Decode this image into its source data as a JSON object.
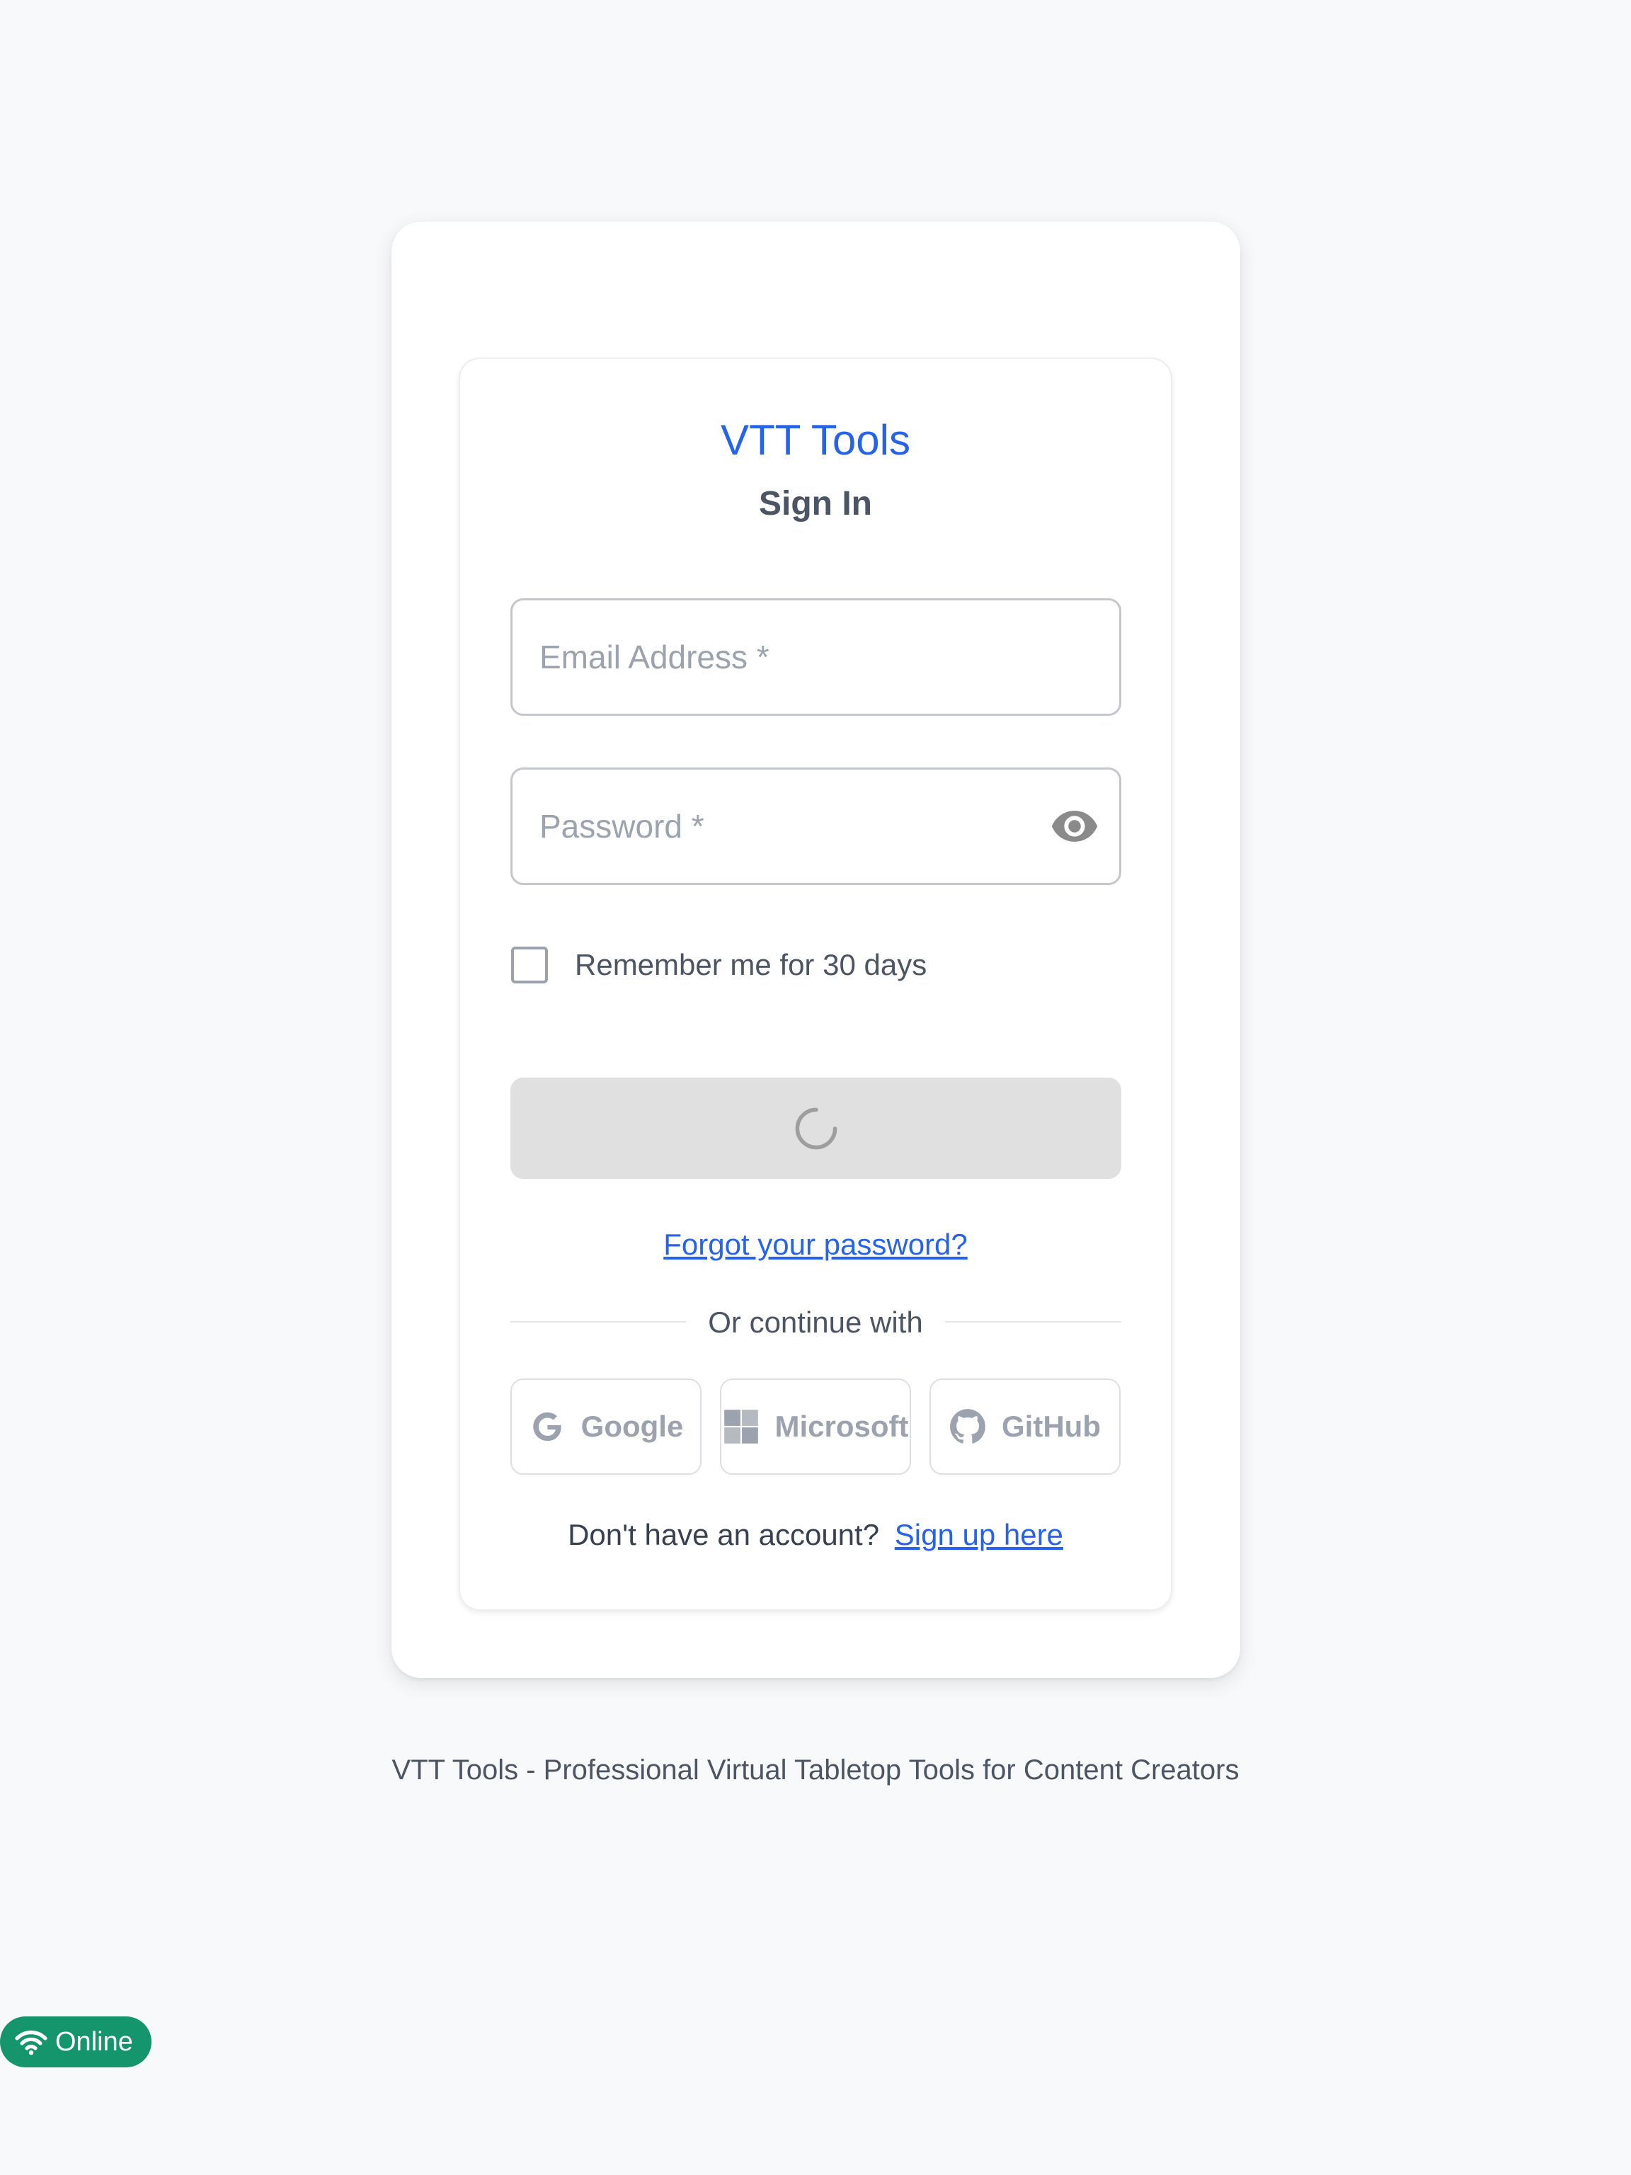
{
  "app": {
    "title": "VTT Tools",
    "subtitle": "Sign In"
  },
  "form": {
    "email_placeholder": "Email Address *",
    "email_value": "",
    "password_placeholder": "Password *",
    "password_value": "",
    "remember_label": "Remember me for 30 days",
    "remember_checked": false,
    "submit_state": "loading",
    "forgot_link": "Forgot your password?"
  },
  "divider": {
    "text": "Or continue with"
  },
  "social": [
    {
      "label": "Google",
      "icon": "google-icon"
    },
    {
      "label": "Microsoft",
      "icon": "microsoft-icon"
    },
    {
      "label": "GitHub",
      "icon": "github-icon"
    }
  ],
  "signup": {
    "prompt": "Don't have an account?",
    "link": "Sign up here"
  },
  "footer": {
    "text": "VTT Tools - Professional Virtual Tabletop Tools for Content Creators"
  },
  "status": {
    "label": "Online",
    "icon": "wifi-icon",
    "color": "#14956b"
  },
  "colors": {
    "accent": "#2563eb",
    "background": "#f8f9fb",
    "disabled_button": "#e0e0e0"
  }
}
